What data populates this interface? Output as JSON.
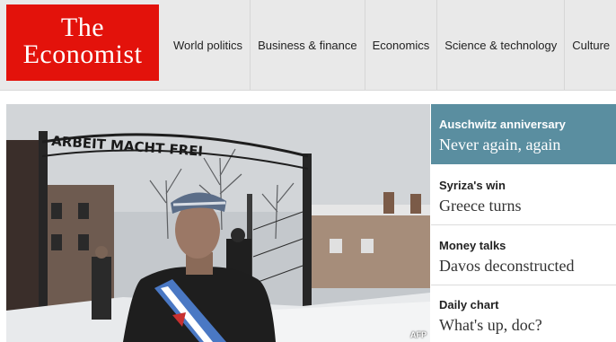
{
  "brand": {
    "line1": "The",
    "line2": "Economist",
    "color": "#e3120b"
  },
  "nav": {
    "items": [
      {
        "label": "World politics"
      },
      {
        "label": "Business & finance"
      },
      {
        "label": "Economics"
      },
      {
        "label": "Science & technology"
      },
      {
        "label": "Culture"
      }
    ]
  },
  "hero": {
    "credit": "AFP",
    "gate_sign": "ARBEIT MACHT FREI",
    "image_description_icon": "photo-image"
  },
  "stories": [
    {
      "kicker": "Auschwitz anniversary",
      "headline": "Never again, again",
      "active": true
    },
    {
      "kicker": "Syriza's win",
      "headline": "Greece turns",
      "active": false
    },
    {
      "kicker": "Money talks",
      "headline": "Davos deconstructed",
      "active": false
    },
    {
      "kicker": "Daily chart",
      "headline": "What's up, doc?",
      "active": false
    }
  ],
  "colors": {
    "header_bg": "#e9e9e9",
    "active_story_bg": "#5a8ea0"
  }
}
